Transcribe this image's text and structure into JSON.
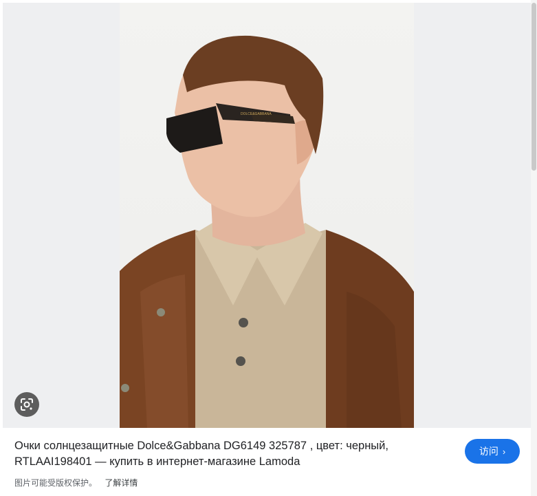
{
  "image_panel": {
    "lens_icon": "google-lens-icon"
  },
  "caption": {
    "title": "Очки солнцезащитные Dolce&Gabbana DG6149 325787 , цвет: черный, RTLAAI198401 — купить в интернет-магазине Lamoda"
  },
  "visit_button": {
    "label": "访问",
    "icon": "chevron-right-icon"
  },
  "footer": {
    "copyright_text": "图片可能受版权保护。",
    "learn_more": "了解详情"
  },
  "colors": {
    "accent": "#1a73e8",
    "image_background": "#eeeff1"
  }
}
